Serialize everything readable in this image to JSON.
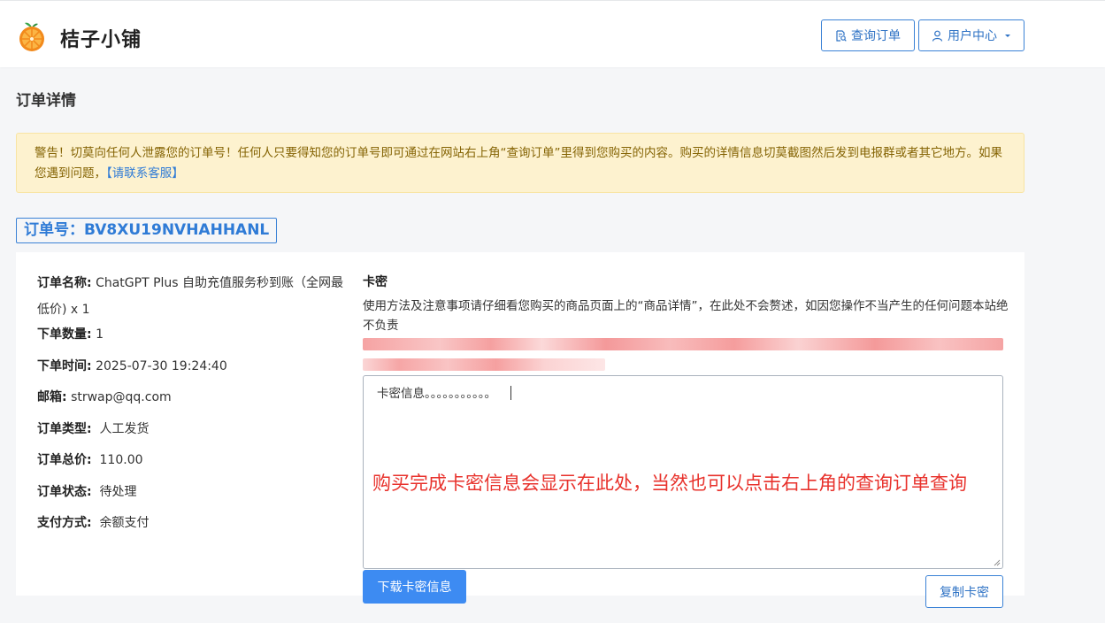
{
  "header": {
    "brand": "桔子小铺",
    "query_order": "查询订单",
    "user_center": "用户中心"
  },
  "page_title": "订单详情",
  "alert": {
    "text": "警告！切莫向任何人泄露您的订单号！任何人只要得知您的订单号即可通过在网站右上角“查询订单”里得到您购买的内容。购买的详情信息切莫截图然后发到电报群或者其它地方。如果您遇到问题，",
    "link": "【请联系客服】"
  },
  "order_no": "订单号：BV8XU19NVHAHHANL",
  "order": {
    "name_label": "订单名称:",
    "name_value": "ChatGPT Plus 自助充值服务秒到账（全网最低价) x 1",
    "qty_label": "下单数量:",
    "qty_value": "1",
    "time_label": "下单时间:",
    "time_value": "2025-07-30 19:24:40",
    "email_label": "邮箱:",
    "email_value": "strwap@qq.com",
    "type_label": "订单类型:",
    "type_value": "人工发货",
    "total_label": "订单总价:",
    "total_value": "110.00",
    "status_label": "订单状态:",
    "status_value": "待处理",
    "pay_label": "支付方式:",
    "pay_value": "余额支付"
  },
  "kami": {
    "title": "卡密",
    "desc": "使用方法及注意事项请仔细看您购买的商品页面上的“商品详情”，在此处不会赘述，如因您操作不当产生的任何问题本站绝不负责",
    "textarea_value": "卡密信息。。。。。。。。。。。",
    "overlay_note": "购买完成卡密信息会显示在此处，当然也可以点击右上角的查询订单查询",
    "download_button": "下载卡密信息",
    "copy_button": "复制卡密"
  },
  "colors": {
    "primary": "#3d8bf2",
    "alert_bg": "#fdf2cf",
    "alert_text": "#856404",
    "note_red": "#e8322c"
  }
}
